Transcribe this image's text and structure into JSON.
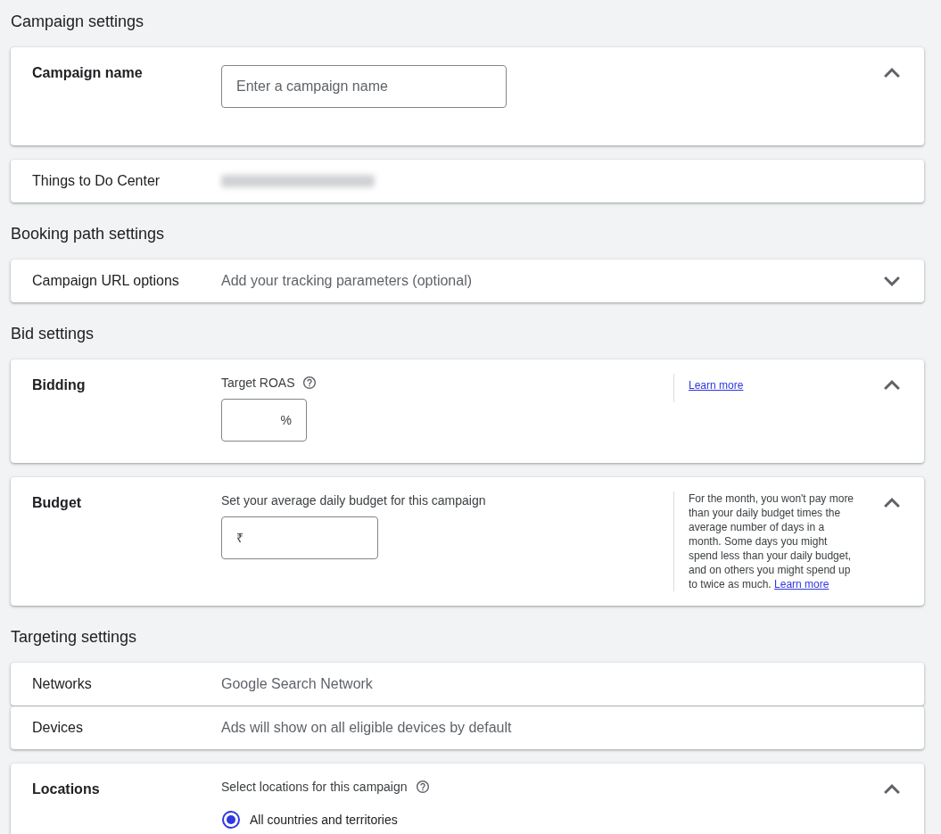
{
  "sections": [
    {
      "title": "Campaign settings",
      "panels": [
        {
          "rows": [
            {
              "kind": "name_input",
              "label": "Campaign name",
              "field": {
                "placeholder": "Enter a campaign name"
              },
              "expanded": true
            }
          ]
        },
        {
          "rows": [
            {
              "kind": "blurred_summary",
              "label": "Things to Do Center"
            }
          ]
        }
      ]
    },
    {
      "title": "Booking path settings",
      "panels": [
        {
          "rows": [
            {
              "kind": "summary",
              "label": "Campaign URL options",
              "value": "Add your tracking parameters (optional)",
              "expanded": false
            }
          ]
        }
      ]
    },
    {
      "title": "Bid settings",
      "panels": [
        {
          "rows": [
            {
              "kind": "amount_input",
              "label": "Bidding",
              "field_label": "Target ROAS",
              "help": true,
              "field": {
                "suffix": "%"
              },
              "aside": {
                "link": "Learn more"
              },
              "expanded": true
            }
          ]
        },
        {
          "rows": [
            {
              "kind": "amount_input",
              "label": "Budget",
              "field_label": "Set your average daily budget for this campaign",
              "field": {
                "prefix": "₹"
              },
              "aside": {
                "text": "For the month, you won't pay more than your daily budget times the average number of days in a month. Some days you might spend less than your daily budget, and on others you might spend up to twice as much.",
                "link": "Learn more"
              },
              "expanded": true
            }
          ]
        }
      ]
    },
    {
      "title": "Targeting settings",
      "panels": [
        {
          "rows": [
            {
              "kind": "summary",
              "label": "Networks",
              "value": "Google Search Network"
            },
            {
              "kind": "summary",
              "label": "Devices",
              "value": "Ads will show on all eligible devices by default"
            }
          ]
        },
        {
          "rows": [
            {
              "kind": "radio_choice",
              "label": "Locations",
              "field_label": "Select locations for this campaign",
              "help": true,
              "options": [
                {
                  "label": "All countries and territories",
                  "selected": true
                }
              ],
              "expanded": true
            }
          ]
        }
      ]
    }
  ]
}
